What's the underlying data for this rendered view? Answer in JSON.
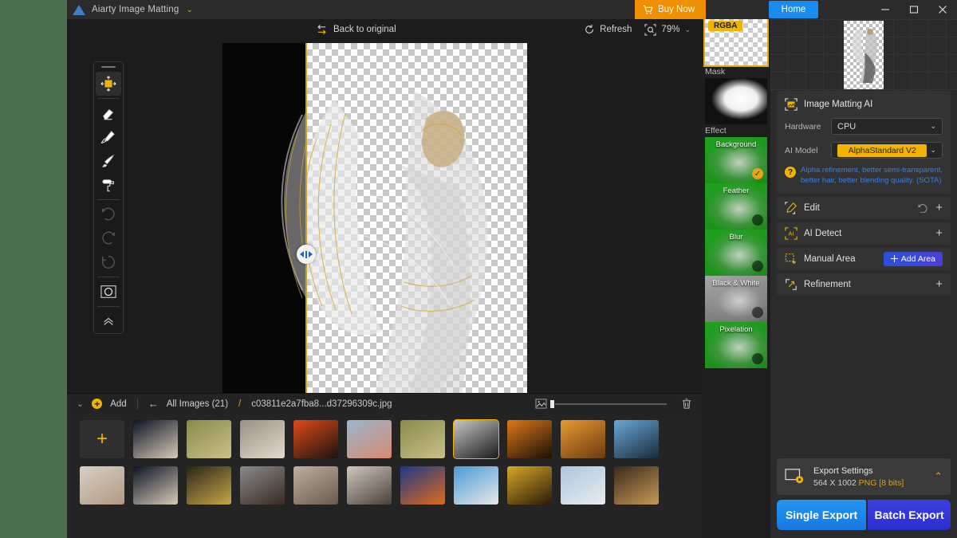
{
  "window": {
    "app_title": "Aiarty Image Matting",
    "title_chevron": "chevron-down",
    "buy_now": "Buy Now",
    "home": "Home",
    "minimize": "–",
    "maximize": "▢",
    "close": "✕"
  },
  "canvas_toolbar": {
    "back_to_original": "Back to original",
    "refresh": "Refresh",
    "zoom_level": "79%"
  },
  "tools": [
    {
      "name": "move-tool",
      "active": true
    },
    {
      "name": "eraser-tool",
      "active": false
    },
    {
      "name": "pencil-tool",
      "active": false
    },
    {
      "name": "brush-tool",
      "active": false
    },
    {
      "name": "paint-roller-tool",
      "active": false
    },
    {
      "name": "undo-tool",
      "active": false,
      "disabled": true
    },
    {
      "name": "redo-tool",
      "active": false,
      "disabled": true
    },
    {
      "name": "reset-tool",
      "active": false,
      "disabled": true
    },
    {
      "name": "circle-select-tool",
      "active": false
    },
    {
      "name": "collapse-tool",
      "active": false
    }
  ],
  "effects_panel": {
    "rgba_badge": "RGBA",
    "mask_label": "Mask",
    "effect_label": "Effect",
    "items": [
      {
        "label": "Background",
        "state": "checked"
      },
      {
        "label": "Feather",
        "state": "dot"
      },
      {
        "label": "Blur",
        "state": "dot"
      },
      {
        "label": "Black & White",
        "state": "dot"
      },
      {
        "label": "Pixelation",
        "state": "dot"
      }
    ]
  },
  "right_panel": {
    "matting": {
      "title": "Image Matting AI",
      "hardware_label": "Hardware",
      "hardware_value": "CPU",
      "model_label": "AI Model",
      "model_value": "AlphaStandard  V2",
      "hint": "Alpha refinement, better semi-transparent, better hair, better blending quality. (SOTA)"
    },
    "rows": [
      {
        "label": "Edit",
        "icon": "edit-icon",
        "action": "plus",
        "has_undo": true
      },
      {
        "label": "AI Detect",
        "icon": "ai-detect-icon",
        "action": "plus",
        "has_undo": false
      },
      {
        "label": "Manual Area",
        "icon": "manual-area-icon",
        "action": "add-area",
        "button_label": "Add Area"
      },
      {
        "label": "Refinement",
        "icon": "refinement-icon",
        "action": "plus",
        "has_undo": false
      }
    ],
    "export": {
      "title": "Export Settings",
      "dimensions": "564 X 1002",
      "format": "PNG",
      "bits": "[8 bits]",
      "single_export": "Single Export",
      "batch_export": "Batch Export"
    }
  },
  "filmstrip": {
    "collapse_icon": "chevron-collapse",
    "add_label": "Add",
    "back_icon": "arrow-left-icon",
    "all_images": "All Images (21)",
    "separator": "/",
    "current_file": "c03811e2a7fba8...d37296309c.jpg",
    "thumb_size_icon": "image-size-icon",
    "delete_icon": "trash-icon",
    "thumbnails": [
      {
        "name": "add-image-tile",
        "kind": "add",
        "label": "+"
      },
      {
        "name": "thumb-jellyfish-1",
        "c1": "#0b1424",
        "c2": "#d8c9b8",
        "sel": false
      },
      {
        "name": "thumb-bicycle-1",
        "c1": "#8a8a4a",
        "c2": "#c9c08a",
        "sel": false
      },
      {
        "name": "thumb-woman-floral",
        "c1": "#9a8f84",
        "c2": "#e4d9cc",
        "sel": false
      },
      {
        "name": "thumb-silhouette",
        "c1": "#e04a18",
        "c2": "#1a1410",
        "sel": false
      },
      {
        "name": "thumb-woman-wind",
        "c1": "#9ab6cc",
        "c2": "#d98a72",
        "sel": false
      },
      {
        "name": "thumb-bicycle-2",
        "c1": "#8a8a4a",
        "c2": "#c9c08a",
        "sel": false
      },
      {
        "name": "thumb-angel-wings",
        "c1": "#c8c8c8",
        "c2": "#1a1a1a",
        "sel": true
      },
      {
        "name": "thumb-crowd-fire",
        "c1": "#e07818",
        "c2": "#1a0f06",
        "sel": false
      },
      {
        "name": "thumb-cat-sunset",
        "c1": "#e89a30",
        "c2": "#6a3a10",
        "sel": false
      },
      {
        "name": "thumb-woman-blue",
        "c1": "#6aa8d8",
        "c2": "#1a2a3a",
        "sel": false
      },
      {
        "name": "thumb-portrait-pale",
        "c1": "#d8cfc4",
        "c2": "#b09a84",
        "sel": false
      },
      {
        "name": "thumb-jellyfish-2",
        "c1": "#0b1424",
        "c2": "#d8c9b8",
        "sel": false
      },
      {
        "name": "thumb-necklace",
        "c1": "#2a2418",
        "c2": "#c8a84a",
        "sel": false
      },
      {
        "name": "thumb-man-beard",
        "c1": "#8a8a8a",
        "c2": "#3a2a22",
        "sel": false
      },
      {
        "name": "thumb-child-craft",
        "c1": "#bdb0a0",
        "c2": "#6a5a4a",
        "sel": false
      },
      {
        "name": "thumb-room-scene",
        "c1": "#cfc8bc",
        "c2": "#4a4038",
        "sel": false
      },
      {
        "name": "thumb-dancer-neon",
        "c1": "#1a3a8a",
        "c2": "#e06a18",
        "sel": false
      },
      {
        "name": "thumb-skater-sky",
        "c1": "#4a9ad8",
        "c2": "#e8e8e8",
        "sel": false
      },
      {
        "name": "thumb-golden-art",
        "c1": "#d8a828",
        "c2": "#2a1a08",
        "sel": false
      },
      {
        "name": "thumb-bride",
        "c1": "#aec6dc",
        "c2": "#e8ecf0",
        "sel": false
      },
      {
        "name": "thumb-man-suit",
        "c1": "#3a2a1a",
        "c2": "#c89858",
        "sel": false
      }
    ]
  },
  "colors": {
    "accent_yellow": "#f0b400",
    "accent_orange": "#f09000",
    "accent_blue": "#1a8cf0",
    "hint_blue": "#3a7fe0",
    "effect_green": "#21a11f",
    "panel_bg": "#2b2b2b",
    "canvas_bg": "#1c1c1c",
    "desktop_bg": "#4a7050"
  }
}
